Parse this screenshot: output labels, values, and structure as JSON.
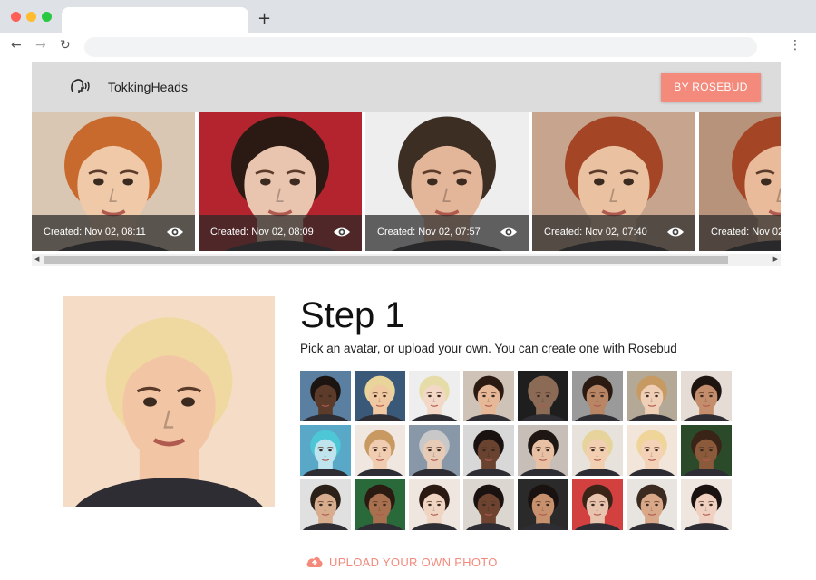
{
  "browser": {
    "new_tab": "+",
    "back": "←",
    "forward": "→",
    "reload": "↻",
    "menu": "⋮"
  },
  "header": {
    "title": "TokkingHeads",
    "button_label": "BY ROSEBUD",
    "logo_icon": "talking-head-icon"
  },
  "gallery": [
    {
      "caption": "Created: Nov 02, 08:11",
      "bg": "#d9c7b3",
      "skin": "#f0c9a8",
      "hair": "#c86a2e"
    },
    {
      "caption": "Created: Nov 02, 08:09",
      "bg": "#b3242e",
      "skin": "#e9c4ae",
      "hair": "#2b1a14"
    },
    {
      "caption": "Created: Nov 02, 07:57",
      "bg": "#eeeeee",
      "skin": "#e3b69a",
      "hair": "#3d2e24"
    },
    {
      "caption": "Created: Nov 02, 07:40",
      "bg": "#c6a48d",
      "skin": "#eac2a2",
      "hair": "#a44526"
    },
    {
      "caption": "Created: Nov 02",
      "bg": "#b8937b",
      "skin": "#e9bb9a",
      "hair": "#a44526"
    }
  ],
  "step": {
    "title": "Step 1",
    "subtitle": "Pick an avatar, or upload your own. You can create one with Rosebud",
    "upload_label": "UPLOAD YOUR OWN PHOTO",
    "upload_icon": "cloud-upload-icon"
  },
  "preview": {
    "bg": "#f5dcc6",
    "skin": "#f2c6a4",
    "hair": "#f0d9a0"
  },
  "avatars": [
    {
      "bg": "#5a7fa0",
      "skin": "#5c3b2a",
      "hair": "#1c1410"
    },
    {
      "bg": "#3a5878",
      "skin": "#f0c8a2",
      "hair": "#e9d49a"
    },
    {
      "bg": "#eeeeee",
      "skin": "#f3d8c8",
      "hair": "#e6dca8"
    },
    {
      "bg": "#cfc2b6",
      "skin": "#e6b898",
      "hair": "#2a1a12"
    },
    {
      "bg": "#1e1e1e",
      "skin": "#8b6b55",
      "hair": "#8b6b55"
    },
    {
      "bg": "#9a9a9a",
      "skin": "#b88565",
      "hair": "#2a1a12"
    },
    {
      "bg": "#b4a896",
      "skin": "#efcfb6",
      "hair": "#c79a62"
    },
    {
      "bg": "#e6dcd6",
      "skin": "#c48e6c",
      "hair": "#1e1410"
    },
    {
      "bg": "#5aa8c8",
      "skin": "#bfe4ee",
      "hair": "#4dc6d6"
    },
    {
      "bg": "#f0e8e0",
      "skin": "#f0cdb0",
      "hair": "#c89a62"
    },
    {
      "bg": "#8898a8",
      "skin": "#e8cbb6",
      "hair": "#c8c8c8"
    },
    {
      "bg": "#d8d8d8",
      "skin": "#6a4230",
      "hair": "#1a1210"
    },
    {
      "bg": "#c8beb8",
      "skin": "#e8c0a4",
      "hair": "#1e1612"
    },
    {
      "bg": "#e8e2dc",
      "skin": "#f3cfb2",
      "hair": "#e6d49c"
    },
    {
      "bg": "#f2e6da",
      "skin": "#f4d2b8",
      "hair": "#efd59a"
    },
    {
      "bg": "#2a4a2a",
      "skin": "#8a5a3a",
      "hair": "#3a2418"
    },
    {
      "bg": "#e0e0e0",
      "skin": "#d8ad8e",
      "hair": "#2a2018"
    },
    {
      "bg": "#2a6a3a",
      "skin": "#a8704e",
      "hair": "#2a1a12"
    },
    {
      "bg": "#efe6e0",
      "skin": "#f0d6c2",
      "hair": "#2a1a12"
    },
    {
      "bg": "#dcd6d0",
      "skin": "#6e4430",
      "hair": "#1a1210"
    },
    {
      "bg": "#2a2a2a",
      "skin": "#c8916e",
      "hair": "#1a1210"
    },
    {
      "bg": "#d24040",
      "skin": "#e8c4ae",
      "hair": "#3a2418"
    },
    {
      "bg": "#e8e4e0",
      "skin": "#d8a888",
      "hair": "#3a2a20"
    },
    {
      "bg": "#efe6e0",
      "skin": "#f0d0c0",
      "hair": "#1a1210"
    }
  ]
}
